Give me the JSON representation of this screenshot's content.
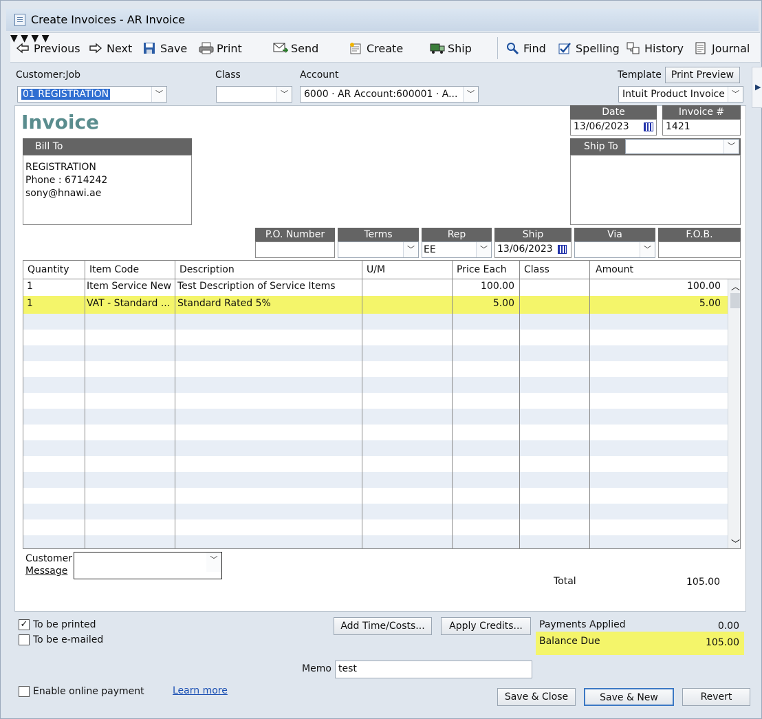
{
  "window": {
    "title": "Create Invoices - AR Invoice"
  },
  "toolbar": {
    "previous": "Previous",
    "next": "Next",
    "save": "Save",
    "print": "Print",
    "send": "Send",
    "create": "Create",
    "ship": "Ship",
    "find": "Find",
    "spelling": "Spelling",
    "history": "History",
    "journal": "Journal"
  },
  "header": {
    "customer_job_label": "Customer:Job",
    "customer_job_value": "01 REGISTRATION",
    "class_label": "Class",
    "class_value": "",
    "account_label": "Account",
    "account_value": "6000 · AR Account:600001 · A...",
    "template_label": "Template",
    "print_preview": "Print Preview",
    "template_value": "Intuit Product Invoice"
  },
  "invoice": {
    "title": "Invoice",
    "date_label": "Date",
    "date_value": "13/06/2023",
    "number_label": "Invoice #",
    "number_value": "1421",
    "bill_to_label": "Bill To",
    "bill_to_lines": [
      "REGISTRATION",
      "Phone : 6714242",
      "sony@hnawi.ae"
    ],
    "ship_to_label": "Ship To",
    "ship_to_value": ""
  },
  "fields": {
    "po_label": "P.O. Number",
    "po_value": "",
    "terms_label": "Terms",
    "terms_value": "",
    "rep_label": "Rep",
    "rep_value": "EE",
    "ship_label": "Ship",
    "ship_value": "13/06/2023",
    "via_label": "Via",
    "via_value": "",
    "fob_label": "F.O.B.",
    "fob_value": ""
  },
  "grid": {
    "columns": [
      "Quantity",
      "Item Code",
      "Description",
      "U/M",
      "Price Each",
      "Class",
      "Amount"
    ],
    "rows": [
      {
        "qty": "1",
        "item": "Item Service New",
        "desc": "Test Description of Service Items",
        "um": "",
        "price": "100.00",
        "class": "",
        "amount": "100.00"
      },
      {
        "qty": "1",
        "item": "VAT - Standard ...",
        "desc": "Standard Rated 5%",
        "um": "",
        "price": "5.00",
        "class": "",
        "amount": "5.00"
      }
    ]
  },
  "footer": {
    "customer_message_label_1": "Customer",
    "customer_message_label_2": "Message",
    "customer_message_value": "",
    "total_label": "Total",
    "total_value": "105.00",
    "to_be_printed": "To be printed",
    "to_be_emailed": "To be e-mailed",
    "add_time_costs": "Add Time/Costs...",
    "apply_credits": "Apply Credits...",
    "payments_applied_label": "Payments Applied",
    "payments_applied_value": "0.00",
    "balance_due_label": "Balance Due",
    "balance_due_value": "105.00",
    "memo_label": "Memo",
    "memo_value": "test",
    "enable_online_payment": "Enable online payment",
    "learn_more": "Learn more",
    "save_close": "Save & Close",
    "save_new": "Save & New",
    "revert": "Revert"
  },
  "colors": {
    "highlight": "#f4f56a",
    "header_dark": "#646464",
    "invoice_title": "#5a8d8e",
    "selection": "#2f6ed1"
  }
}
